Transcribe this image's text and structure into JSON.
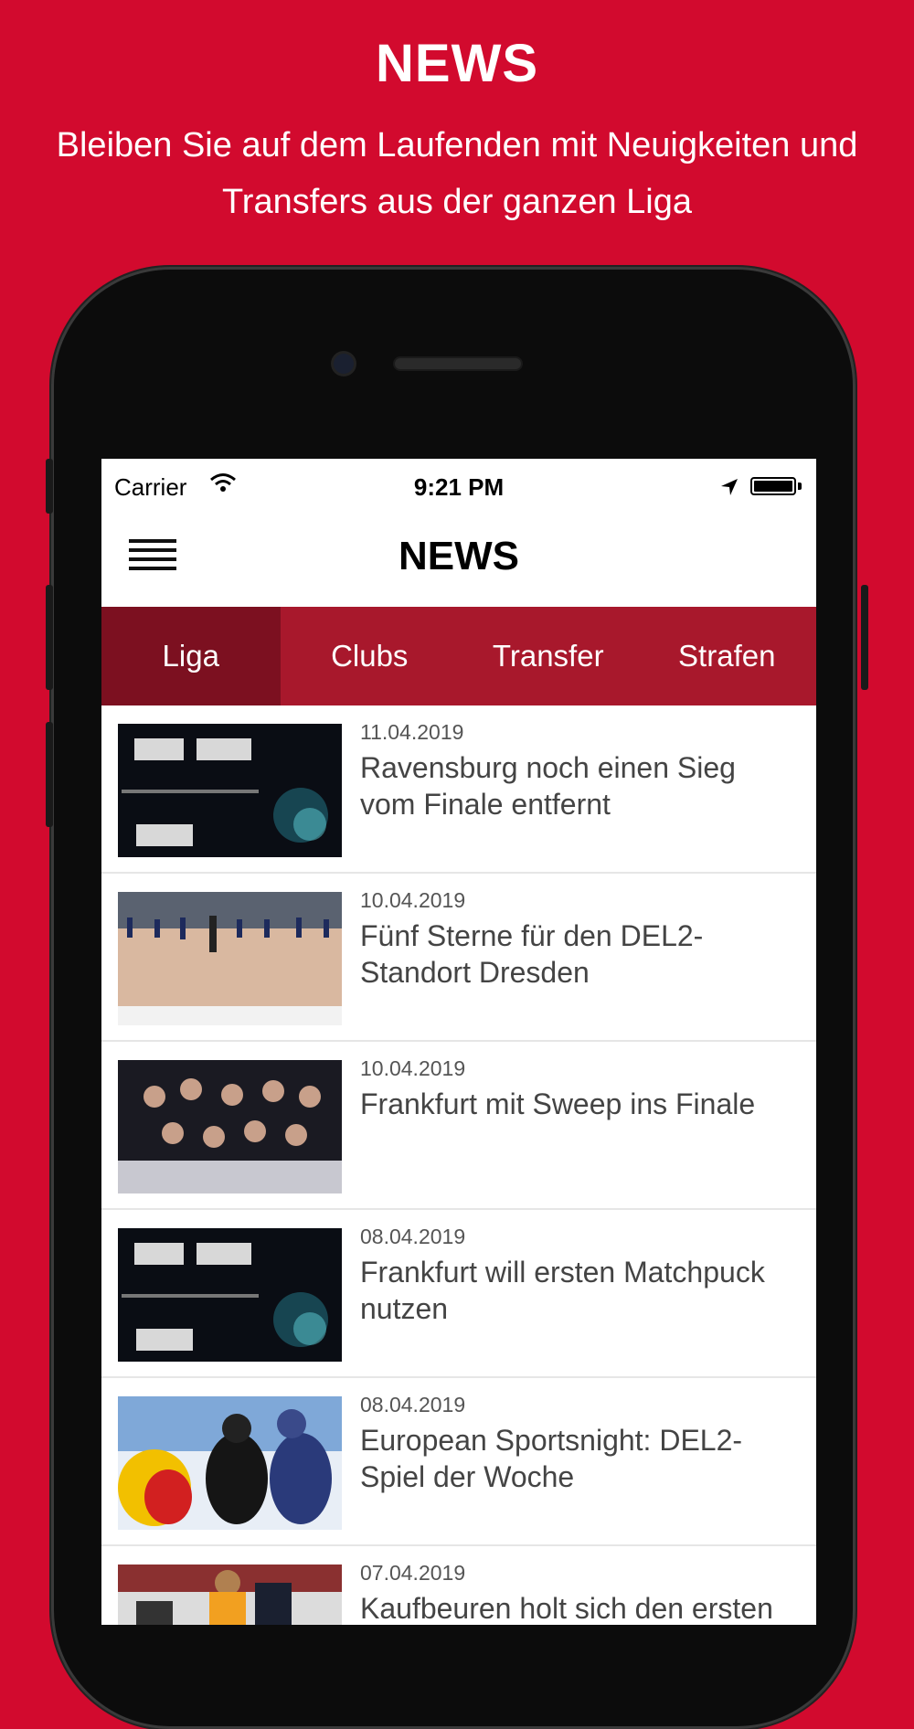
{
  "promo": {
    "title": "NEWS",
    "subtitle": "Bleiben Sie auf dem Laufenden mit Neuigkeiten und Transfers aus der ganzen Liga"
  },
  "statusbar": {
    "carrier": "Carrier",
    "time": "9:21 PM"
  },
  "navbar": {
    "title": "NEWS",
    "menu_icon": "hamburger-menu-icon"
  },
  "tabs": [
    {
      "label": "Liga",
      "active": true
    },
    {
      "label": "Clubs",
      "active": false
    },
    {
      "label": "Transfer",
      "active": false
    },
    {
      "label": "Strafen",
      "active": false
    }
  ],
  "news": [
    {
      "date": "11.04.2019",
      "title": "Ravensburg noch einen Sieg vom Finale entfernt",
      "thumb": "scoreboard"
    },
    {
      "date": "10.04.2019",
      "title": "Fünf Sterne für den DEL2-Standort Dresden",
      "thumb": "rink"
    },
    {
      "date": "10.04.2019",
      "title": "Frankfurt mit Sweep ins Finale",
      "thumb": "team"
    },
    {
      "date": "08.04.2019",
      "title": "Frankfurt will ersten Matchpuck nutzen",
      "thumb": "scoreboard"
    },
    {
      "date": "08.04.2019",
      "title": "European Sportsnight: DEL2-Spiel der Woche",
      "thumb": "faceoff"
    },
    {
      "date": "07.04.2019",
      "title": "Kaufbeuren holt sich den ersten",
      "thumb": "game"
    }
  ],
  "colors": {
    "background": "#d20a2e",
    "tab_bar": "#a8182c",
    "tab_active": "#7c1020"
  }
}
